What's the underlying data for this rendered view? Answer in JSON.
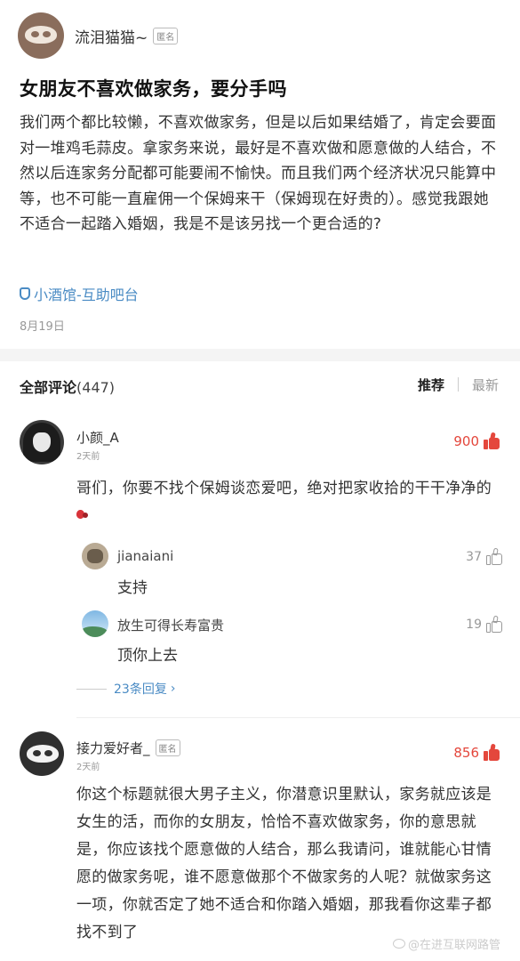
{
  "post": {
    "author": "流泪猫猫~",
    "anon_tag": "匿名",
    "title": "女朋友不喜欢做家务，要分手吗",
    "body": "我们两个都比较懒，不喜欢做家务，但是以后如果结婚了，肯定会要面对一堆鸡毛蒜皮。拿家务来说，最好是不喜欢做和愿意做的人结合，不然以后连家务分配都可能要闹不愉快。而且我们两个经济状况只能算中等，也不可能一直雇佣一个保姆来干（保姆现在好贵的）。感觉我跟她不适合一起踏入婚姻，我是不是该另找一个更合适的?",
    "board": "小酒馆-互助吧台",
    "date": "8月19日"
  },
  "comments_header": {
    "title": "全部评论",
    "count": "(447)",
    "sort_hot": "推荐",
    "sort_new": "最新"
  },
  "comments": [
    {
      "name": "小颜_A",
      "time": "2天前",
      "likes": "900",
      "text": "哥们，你要不找个保姆谈恋爱吧，绝对把家收拾的干干净净的",
      "replies": [
        {
          "name": "jianaiani",
          "likes": "37",
          "text": "支持"
        },
        {
          "name": "放生可得长寿富贵",
          "likes": "19",
          "text": "顶你上去"
        }
      ],
      "more_replies": "23条回复"
    },
    {
      "name": "接力爱好者_",
      "anon_tag": "匿名",
      "time": "2天前",
      "likes": "856",
      "text": "你这个标题就很大男子主义，你潜意识里默认，家务就应该是女生的活，而你的女朋友，恰恰不喜欢做家务，你的意思就是，你应该找个愿意做的人结合，那么我请问，谁就能心甘情愿的做家务呢，谁不愿意做那个不做家务的人呢？就做家务这一项，你就否定了她不适合和你踏入婚姻，那我看你这辈子都找不到了"
    }
  ],
  "watermark": "@在进互联网路管",
  "colors": {
    "accent_blue": "#4a8bc4",
    "like_red": "#e4473c",
    "muted": "#999999"
  }
}
